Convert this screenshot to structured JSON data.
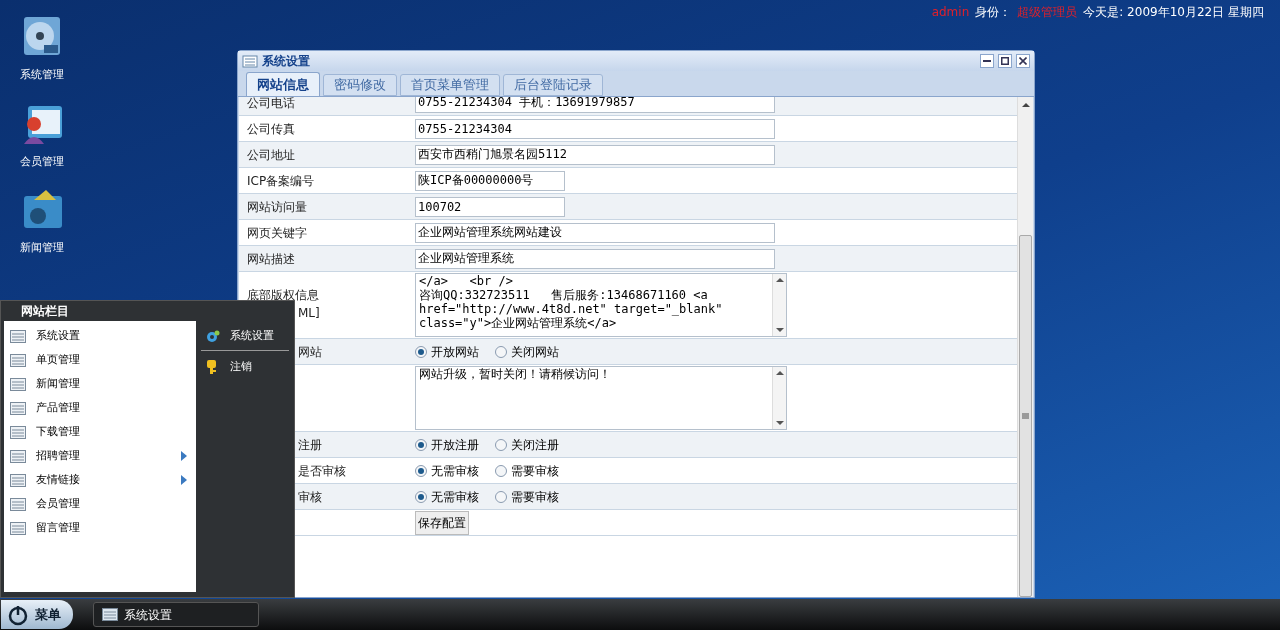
{
  "top_bar": {
    "user": "admin",
    "role_label": "身份：",
    "role": "超级管理员",
    "date": "今天是: 2009年10月22日 星期四"
  },
  "desktop_icons": [
    {
      "label": "系统管理",
      "kind": "disc"
    },
    {
      "label": "会员管理",
      "kind": "person"
    },
    {
      "label": "新闻管理",
      "kind": "news"
    }
  ],
  "dialog": {
    "title": "系统设置",
    "tabs": [
      {
        "label": "网站信息",
        "selected": true
      },
      {
        "label": "密码修改",
        "selected": false
      },
      {
        "label": "首页菜单管理",
        "selected": false
      },
      {
        "label": "后台登陆记录",
        "selected": false
      }
    ],
    "rows": [
      {
        "kind": "input",
        "label": "公司电话",
        "value": "0755-21234304 手机：13691979857"
      },
      {
        "kind": "input",
        "label": "公司传真",
        "value": "0755-21234304"
      },
      {
        "kind": "input",
        "label": "公司地址",
        "value": "西安市西稍门旭景名园5112"
      },
      {
        "kind": "short_input",
        "label": "ICP备案编号",
        "value": "陕ICP备00000000号"
      },
      {
        "kind": "short_input",
        "label": "网站访问量",
        "value": "100702"
      },
      {
        "kind": "input",
        "label": "网页关键字",
        "value": "企业网站管理系统网站建设"
      },
      {
        "kind": "input",
        "label": "网站描述",
        "value": "企业网站管理系统"
      },
      {
        "kind": "textarea",
        "label": "底部版权信息",
        "label_note": "ML]",
        "value": "</a>   <br />\n咨询QQ:332723511   售后服务:13468671160 <a\nhref=\"http://www.4t8d.net\" target=\"_blank\"\nclass=\"y\">企业网站管理系统</a>"
      },
      {
        "kind": "radio",
        "label": "网站",
        "options": [
          {
            "label": "开放网站",
            "selected": true
          },
          {
            "label": "关闭网站",
            "selected": false
          }
        ]
      },
      {
        "kind": "textarea",
        "value": "网站升级，暂时关闭！请稍候访问！"
      },
      {
        "kind": "radio",
        "label": "注册",
        "options": [
          {
            "label": "开放注册",
            "selected": true
          },
          {
            "label": "关闭注册",
            "selected": false
          }
        ]
      },
      {
        "kind": "radio",
        "label": "是否审核",
        "options": [
          {
            "label": "无需审核",
            "selected": true
          },
          {
            "label": "需要审核",
            "selected": false
          }
        ]
      },
      {
        "kind": "radio",
        "label": "审核",
        "options": [
          {
            "label": "无需审核",
            "selected": true
          },
          {
            "label": "需要审核",
            "selected": false
          }
        ]
      },
      {
        "kind": "button",
        "label_button": "保存配置"
      }
    ]
  },
  "start_menu": {
    "title": "网站栏目",
    "items": [
      {
        "label": "系统设置",
        "submenu": false
      },
      {
        "label": "单页管理",
        "submenu": false
      },
      {
        "label": "新闻管理",
        "submenu": false
      },
      {
        "label": "产品管理",
        "submenu": false
      },
      {
        "label": "下载管理",
        "submenu": false
      },
      {
        "label": "招聘管理",
        "submenu": true
      },
      {
        "label": "友情链接",
        "submenu": true
      },
      {
        "label": "会员管理",
        "submenu": false
      },
      {
        "label": "留言管理",
        "submenu": false
      }
    ],
    "side_items": [
      {
        "label": "系统设置",
        "kind": "gear"
      },
      {
        "label": "注销",
        "kind": "key"
      }
    ]
  },
  "taskbar": {
    "start_label": "菜单",
    "tasks": [
      {
        "label": "系统设置",
        "active": true
      }
    ]
  }
}
